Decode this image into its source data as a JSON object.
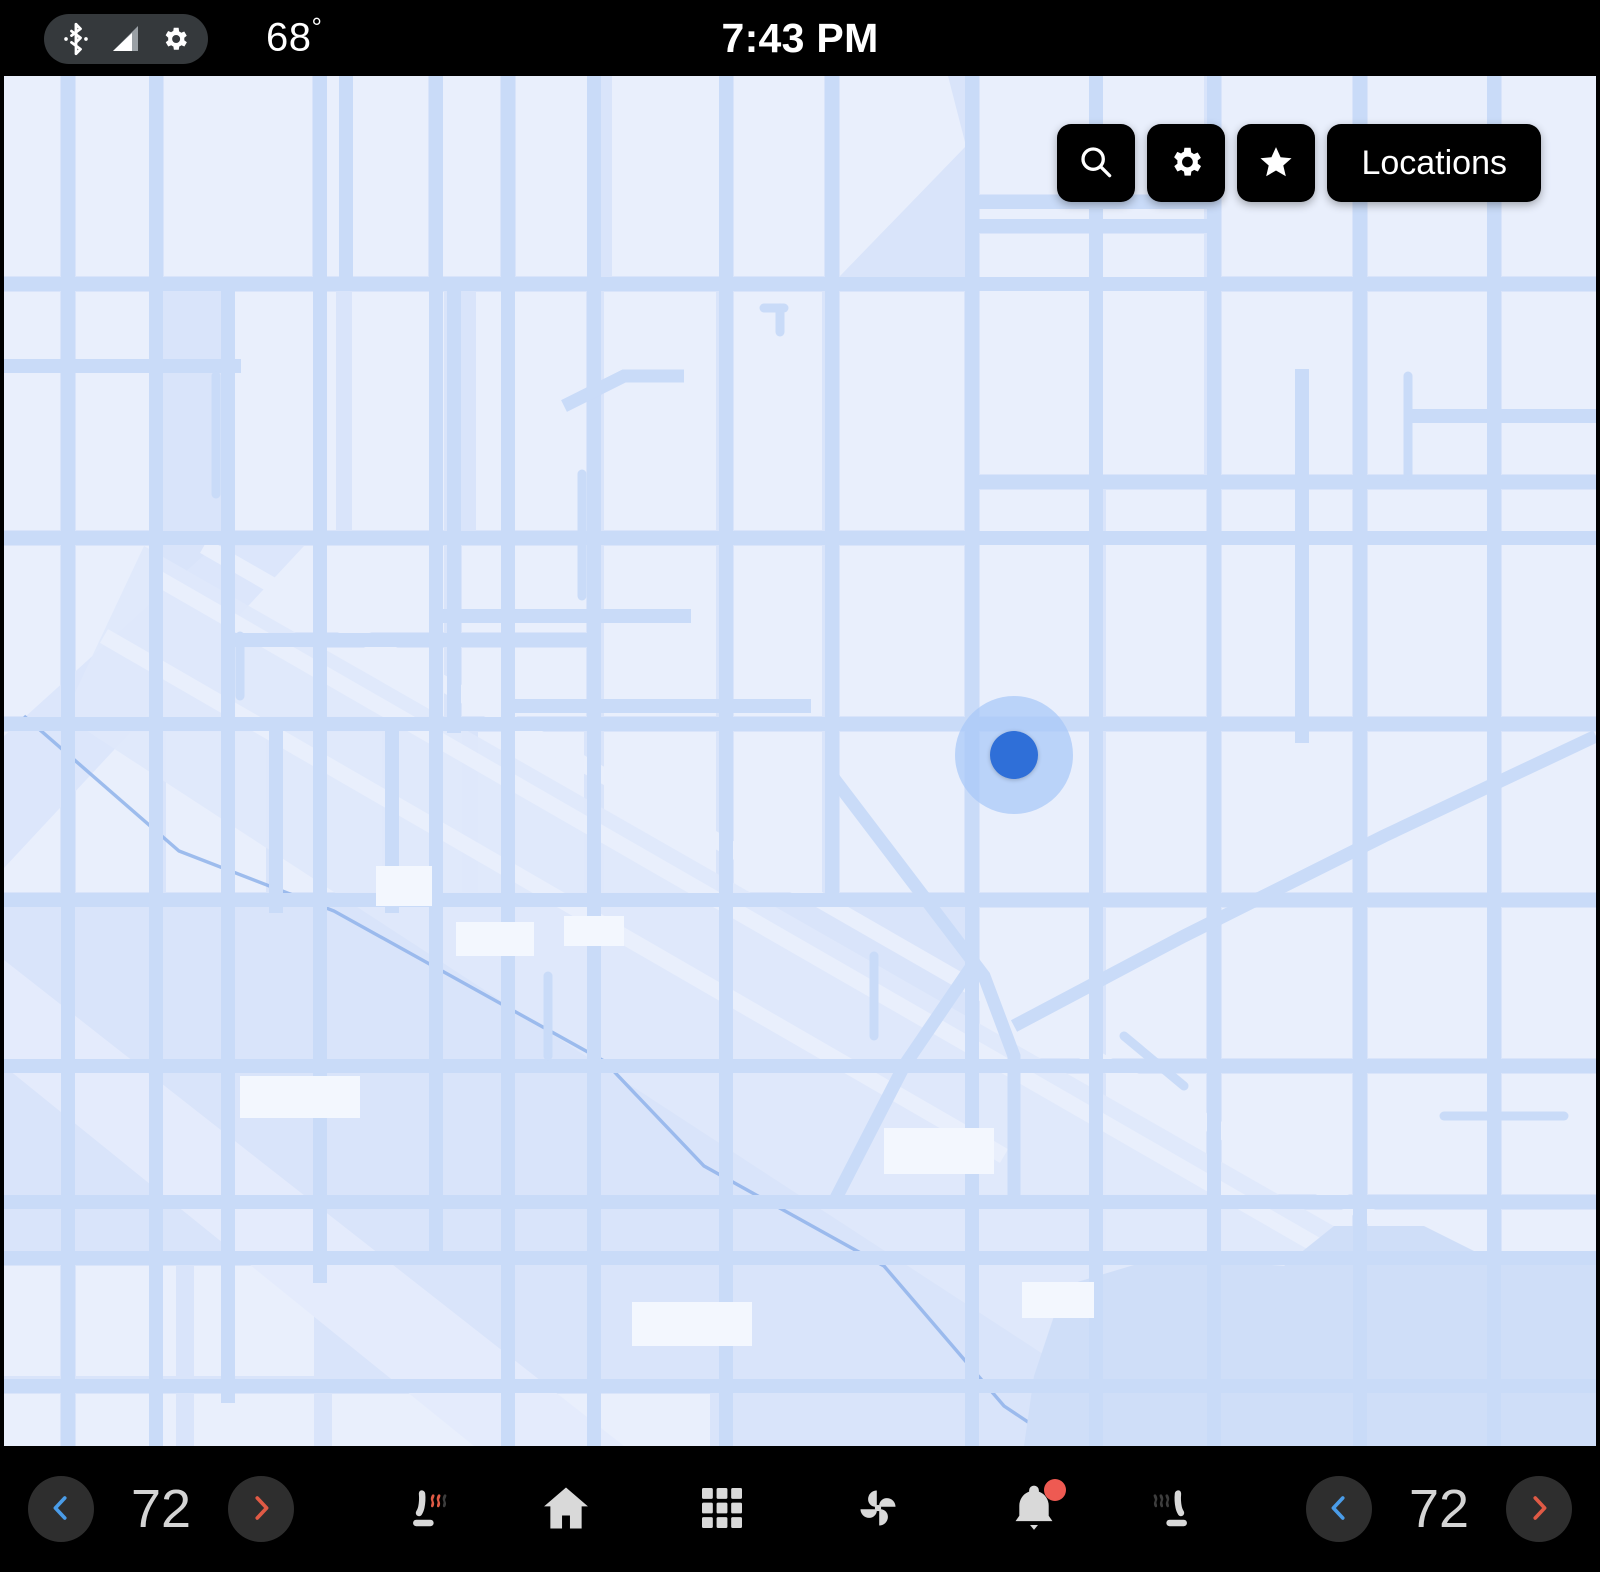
{
  "status_bar": {
    "bluetooth_icon": "bluetooth-icon",
    "signal_icon": "cellular-signal-icon",
    "gear_icon": "gear-icon",
    "outside_temp": "68",
    "degree_symbol": "°",
    "clock": "7:43 PM"
  },
  "map": {
    "background_color": "#E7EEFC",
    "road_color": "#C9DBF8",
    "block_color": "#E9EFFC",
    "water_color": "#A9C6F0",
    "marker": {
      "name": "current-location-marker",
      "core_color": "#2F6FD8",
      "halo_color": "#A8C8F8"
    },
    "toolbar": {
      "search_icon": "search-icon",
      "settings_icon": "gear-icon",
      "favorites_icon": "star-icon",
      "locations_label": "Locations"
    }
  },
  "bottom_bar": {
    "driver_climate": {
      "decrease_label": "‹",
      "temperature": "72",
      "increase_label": "›",
      "seat_heater_icon": "heated-seat-icon",
      "seat_heater_active": true
    },
    "passenger_climate": {
      "seat_heater_icon": "heated-seat-icon",
      "seat_heater_active": false,
      "decrease_label": "‹",
      "temperature": "72",
      "increase_label": "›"
    },
    "nav": [
      {
        "name": "home-icon",
        "label": "Home"
      },
      {
        "name": "apps-grid-icon",
        "label": "Apps"
      },
      {
        "name": "fan-icon",
        "label": "Climate"
      },
      {
        "name": "bell-icon",
        "label": "Notifications",
        "badge": true
      }
    ],
    "colors": {
      "cool_accent": "#4A9CE8",
      "heat_accent": "#E05A45",
      "icon_gray": "#D4D4D4",
      "badge_red": "#EE5A52"
    }
  }
}
